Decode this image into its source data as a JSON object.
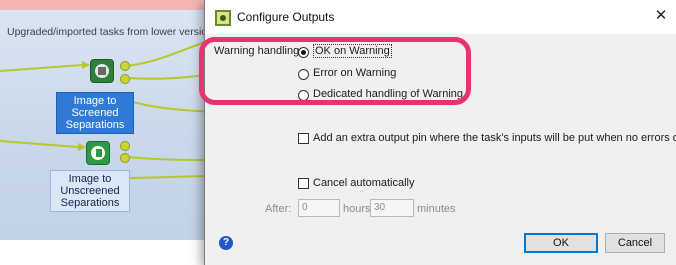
{
  "canvas": {
    "title": "Upgraded/imported tasks from lower version",
    "nodes": [
      {
        "label_lines": [
          "Image to",
          "Screened",
          "Separations"
        ]
      },
      {
        "label_lines": [
          "Image to",
          "Unscreened",
          "Separations"
        ]
      }
    ]
  },
  "dialog": {
    "title": "Configure Outputs",
    "warning_handling_label": "Warning handling:",
    "warning_options": [
      {
        "label": "OK on Warning",
        "selected": true
      },
      {
        "label": "Error on Warning",
        "selected": false
      },
      {
        "label": "Dedicated handling of Warning",
        "selected": false
      }
    ],
    "extra_output_label": "Add an extra output pin where the task's inputs will be put when no errors occur",
    "extra_output_checked": false,
    "cancel_auto_label": "Cancel automatically",
    "cancel_auto_checked": false,
    "after_label": "After:",
    "hours_value": "0",
    "hours_label": "hours",
    "minutes_value": "30",
    "minutes_label": "minutes",
    "ok_label": "OK",
    "cancel_label": "Cancel"
  },
  "colors": {
    "highlight": "#e9336f",
    "canvas_bg": "#c9d8ea",
    "node_label_bg": "#2e7ad6",
    "wire": "#c8d637",
    "help_icon": "#2457c5"
  },
  "icons": [
    "app-icon",
    "close-icon",
    "help-icon",
    "error-badge-icon",
    "task-icon"
  ]
}
